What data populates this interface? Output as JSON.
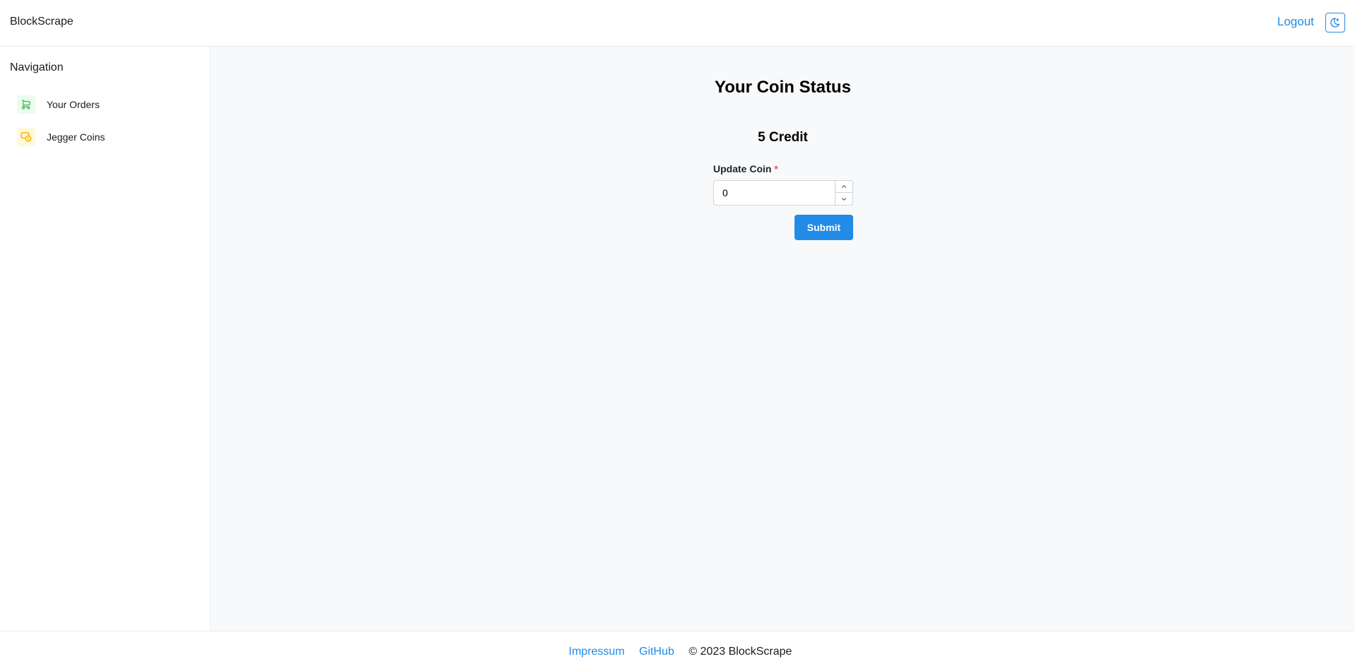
{
  "header": {
    "brand": "BlockScrape",
    "logout_label": "Logout",
    "theme_icon": "moon-icon"
  },
  "sidebar": {
    "title": "Navigation",
    "items": [
      {
        "label": "Your Orders",
        "icon": "cart-icon",
        "color": "#40c057"
      },
      {
        "label": "Jegger Coins",
        "icon": "coin-icon",
        "color": "#fab005"
      }
    ]
  },
  "main": {
    "title": "Your Coin Status",
    "credit": "5 Credit",
    "form": {
      "label": "Update Coin",
      "required_mark": "*",
      "value": "0",
      "submit_label": "Submit"
    }
  },
  "footer": {
    "links": [
      "Impressum",
      "GitHub"
    ],
    "copyright": "© 2023 BlockScrape"
  },
  "colors": {
    "accent": "#228be6",
    "required": "#fa5252",
    "main_bg": "#f8f9fa"
  }
}
